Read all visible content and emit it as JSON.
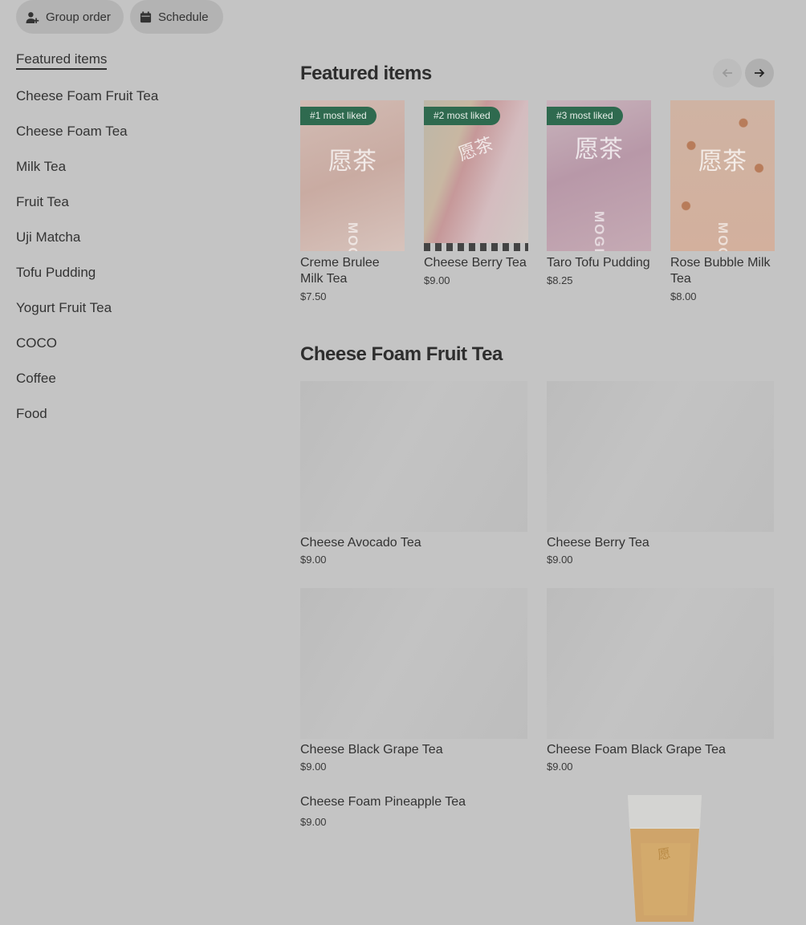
{
  "header": {
    "group_order_label": "Group order",
    "schedule_label": "Schedule"
  },
  "sidebar": {
    "items": [
      {
        "label": "Featured items"
      },
      {
        "label": "Cheese Foam Fruit Tea"
      },
      {
        "label": "Cheese Foam Tea"
      },
      {
        "label": "Milk Tea"
      },
      {
        "label": "Fruit Tea"
      },
      {
        "label": "Uji Matcha"
      },
      {
        "label": "Tofu Pudding"
      },
      {
        "label": "Yogurt Fruit Tea"
      },
      {
        "label": "COCO"
      },
      {
        "label": "Coffee"
      },
      {
        "label": "Food"
      }
    ]
  },
  "featured": {
    "title": "Featured items",
    "items": [
      {
        "badge": "#1 most liked",
        "name": "Creme Brulee Milk Tea",
        "price": "$7.50",
        "logo": "愿茶",
        "brand": "MOGE"
      },
      {
        "badge": "#2 most liked",
        "name": "Cheese Berry Tea",
        "price": "$9.00",
        "logo": "愿茶",
        "brand": ""
      },
      {
        "badge": "#3 most liked",
        "name": "Taro Tofu Pudding",
        "price": "$8.25",
        "logo": "愿茶",
        "brand": "MOGE"
      },
      {
        "badge": "",
        "name": "Rose Bubble Milk Tea",
        "price": "$8.00",
        "logo": "愿茶",
        "brand": "MOGE"
      }
    ]
  },
  "cheese_foam_fruit_tea": {
    "title": "Cheese Foam Fruit Tea",
    "items": [
      {
        "name": "Cheese Avocado Tea",
        "price": "$9.00"
      },
      {
        "name": "Cheese Berry Tea",
        "price": "$9.00"
      },
      {
        "name": "Cheese Black Grape Tea",
        "price": "$9.00"
      },
      {
        "name": "Cheese Foam Black Grape Tea",
        "price": "$9.00"
      },
      {
        "name": "Cheese Foam Pineapple Tea",
        "price": "$9.00"
      }
    ]
  },
  "icons": {
    "group_order": "add-person-icon",
    "schedule": "calendar-icon",
    "prev": "arrow-left-icon",
    "next": "arrow-right-icon"
  }
}
